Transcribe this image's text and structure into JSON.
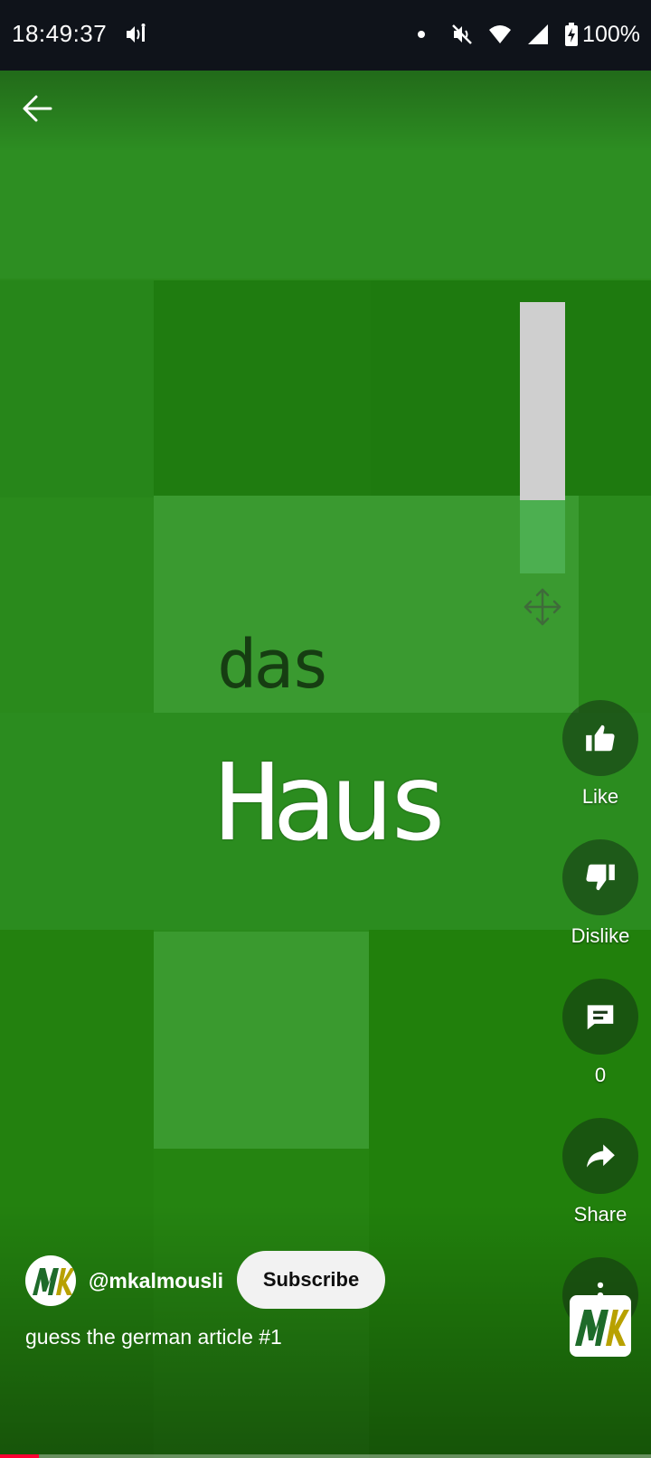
{
  "status_bar": {
    "time": "18:49:37",
    "battery_percent": "100%",
    "icons": [
      "media-cast-icon",
      "dot-icon",
      "vibrate-off-icon",
      "wifi-icon",
      "cell-signal-icon",
      "battery-charging-icon"
    ]
  },
  "video": {
    "article_word": "das",
    "noun_word": "Haus",
    "meter_level": 0.27,
    "colors": {
      "background": "#2a8a1c",
      "meter_track": "#cfcfcf",
      "meter_fill": "#4caf50"
    }
  },
  "actions": {
    "like_label": "Like",
    "dislike_label": "Dislike",
    "comments_count": "0",
    "share_label": "Share"
  },
  "channel": {
    "handle": "@mkalmousli",
    "subscribe_label": "Subscribe",
    "logo_text": "MK"
  },
  "caption": "guess the german article #1",
  "progress": 0.06,
  "colors": {
    "progress_fill": "#ff0033"
  }
}
